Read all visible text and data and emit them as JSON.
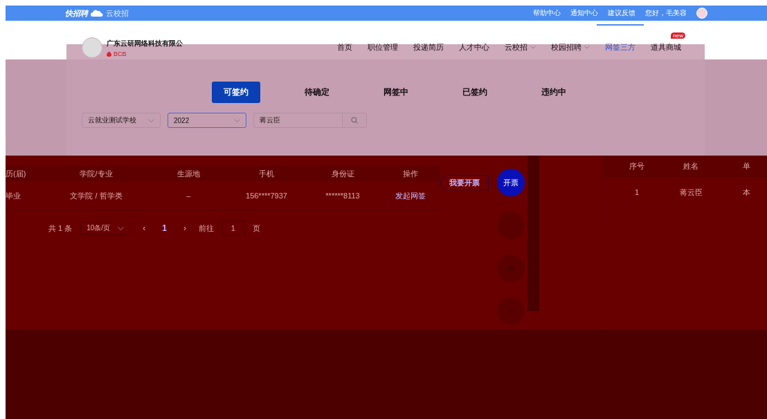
{
  "top_bar": {
    "logo": "快招聘",
    "sub_logo": "云校招",
    "links": [
      "帮助中心",
      "通知中心",
      "建议反馈"
    ],
    "greeting": "您好，毛美容"
  },
  "company": {
    "name": "广东云研网络科技有限公",
    "badge": "BCB"
  },
  "nav": [
    {
      "label": "首页",
      "selected": false,
      "dropdown": false
    },
    {
      "label": "职位管理",
      "selected": false,
      "dropdown": false
    },
    {
      "label": "投递简历",
      "selected": false,
      "dropdown": false
    },
    {
      "label": "人才中心",
      "selected": false,
      "dropdown": false
    },
    {
      "label": "云校招",
      "selected": false,
      "dropdown": true
    },
    {
      "label": "校园招聘",
      "selected": false,
      "dropdown": true
    },
    {
      "label": "网签三方",
      "selected": true,
      "dropdown": false
    },
    {
      "label": "道具商城",
      "selected": false,
      "dropdown": false,
      "badge": "new"
    }
  ],
  "status_tabs": [
    {
      "label": "可签约",
      "selected": true
    },
    {
      "label": "待确定",
      "selected": false
    },
    {
      "label": "网签中",
      "selected": false
    },
    {
      "label": "已签约",
      "selected": false
    },
    {
      "label": "违约中",
      "selected": false
    }
  ],
  "filters": {
    "school": "云就业测试学校",
    "year": "2022",
    "year_focused": true,
    "search": "蒋云臣"
  },
  "table": {
    "columns": [
      "历(届)",
      "学院/专业",
      "生源地",
      "手机",
      "身份证",
      "操作"
    ],
    "rows": [
      {
        "cells": [
          "毕业",
          "文学院 / 哲学类",
          "–",
          "156****7937",
          "******8113"
        ],
        "action": "发起网签"
      }
    ]
  },
  "pagination": {
    "total": "共 1 条",
    "page_size": "10条/页",
    "prev": "‹",
    "pages": [
      {
        "label": "1",
        "selected": true
      }
    ],
    "next": "›",
    "goto_label": "前往",
    "goto_value": "1",
    "goto_suffix": "页"
  },
  "float_actions": {
    "invoice_button": "我要开票",
    "circles": [
      {
        "kind": "text",
        "label": "开票",
        "selected": true
      },
      {
        "kind": "blank",
        "selected": false
      },
      {
        "kind": "chat",
        "selected": false
      },
      {
        "kind": "edit",
        "selected": false
      }
    ]
  },
  "side_table": {
    "columns": [
      "序号",
      "姓名",
      "单"
    ],
    "rows": [
      [
        "1",
        "蒋云臣",
        "本"
      ]
    ]
  }
}
